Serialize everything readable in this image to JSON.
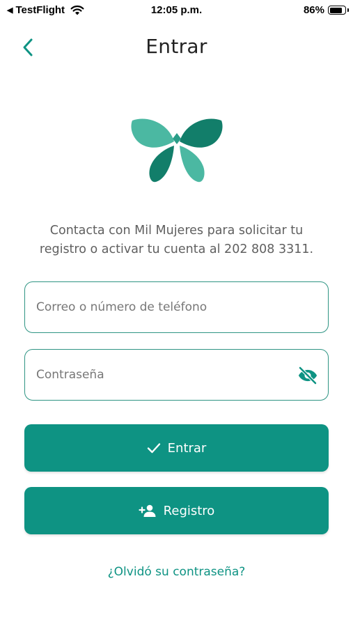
{
  "status_bar": {
    "back_app": "TestFlight",
    "back_glyph": "◀",
    "time": "12:05 p.m.",
    "battery_percent": "86%",
    "battery_level": 0.86
  },
  "header": {
    "title": "Entrar",
    "back_icon": "chevron-left-icon"
  },
  "logo": {
    "icon": "butterfly-logo",
    "colors": {
      "light": "#4bb8a2",
      "dark": "#127e6a",
      "mid": "#2a9d88"
    }
  },
  "info": {
    "line1": "Contacta con Mil Mujeres para solicitar tu",
    "line2": "registro o activar tu cuenta al 202 808 3311."
  },
  "form": {
    "email_placeholder": "Correo o número de teléfono",
    "email_value": "",
    "password_placeholder": "Contraseña",
    "password_value": "",
    "password_toggle_icon": "eye-off-icon"
  },
  "buttons": {
    "login_label": "Entrar",
    "login_icon": "check-icon",
    "register_label": "Registro",
    "register_icon": "person-add-icon"
  },
  "links": {
    "forgot_password": "¿Olvidó su contraseña?"
  },
  "theme": {
    "accent": "#0e9383",
    "border": "#2e9483",
    "text_muted": "#5f5f5f"
  }
}
